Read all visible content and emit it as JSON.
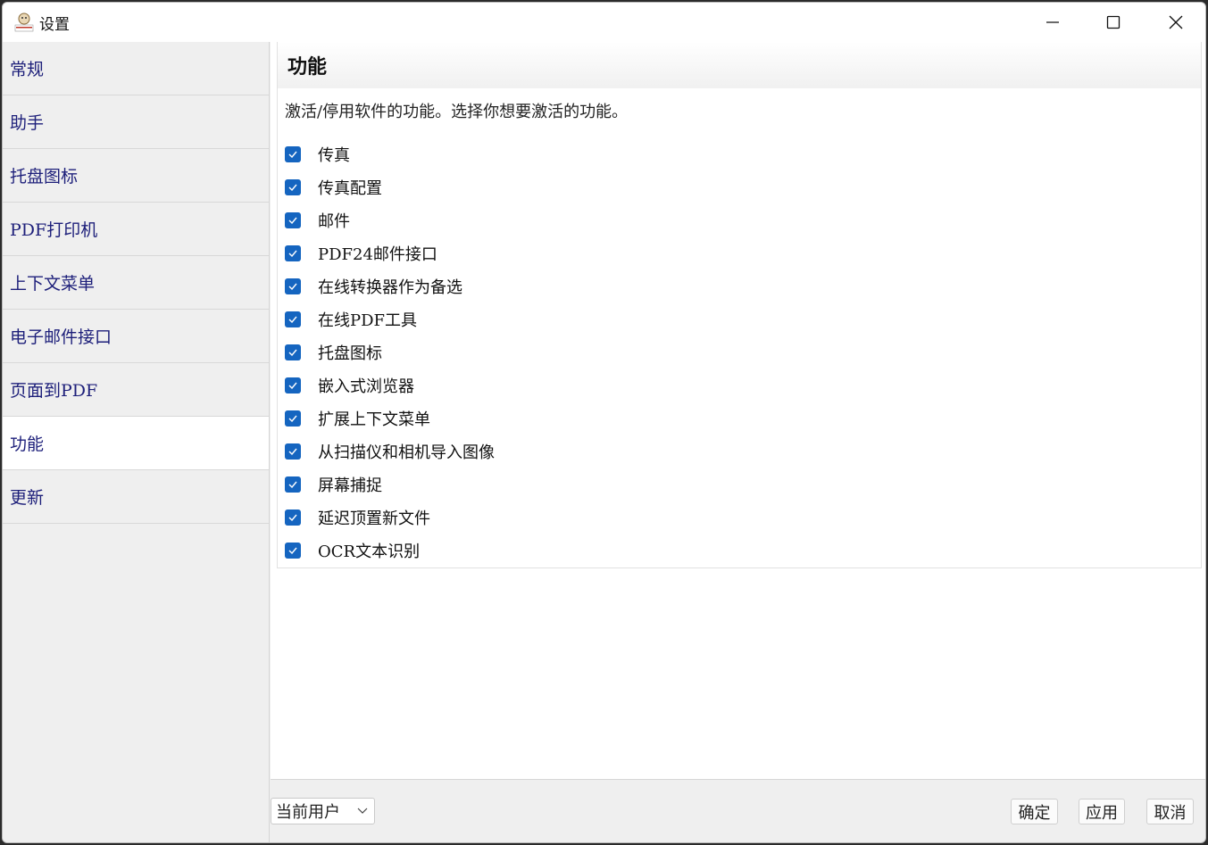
{
  "window": {
    "title": "设置"
  },
  "sidebar": {
    "items": [
      {
        "label": "常规"
      },
      {
        "label": "助手"
      },
      {
        "label": "托盘图标"
      },
      {
        "label": "PDF打印机"
      },
      {
        "label": "上下文菜单"
      },
      {
        "label": "电子邮件接口"
      },
      {
        "label": "页面到PDF"
      },
      {
        "label": "功能",
        "active": true
      },
      {
        "label": "更新"
      }
    ]
  },
  "main": {
    "heading": "功能",
    "description": "激活/停用软件的功能。选择你想要激活的功能。",
    "features": [
      {
        "label": "传真",
        "checked": true
      },
      {
        "label": "传真配置",
        "checked": true
      },
      {
        "label": "邮件",
        "checked": true
      },
      {
        "label": "PDF24邮件接口",
        "checked": true
      },
      {
        "label": "在线转换器作为备选",
        "checked": true
      },
      {
        "label": "在线PDF工具",
        "checked": true
      },
      {
        "label": "托盘图标",
        "checked": true
      },
      {
        "label": "嵌入式浏览器",
        "checked": true
      },
      {
        "label": "扩展上下文菜单",
        "checked": true
      },
      {
        "label": "从扫描仪和相机导入图像",
        "checked": true
      },
      {
        "label": "屏幕捕捉",
        "checked": true
      },
      {
        "label": "延迟顶置新文件",
        "checked": true
      },
      {
        "label": "OCR文本识别",
        "checked": true
      }
    ]
  },
  "footer": {
    "scope_select": "当前用户",
    "ok_label": "确定",
    "apply_label": "应用",
    "cancel_label": "取消"
  },
  "colors": {
    "accent": "#1565c0",
    "nav_text": "#1d1f7a"
  }
}
